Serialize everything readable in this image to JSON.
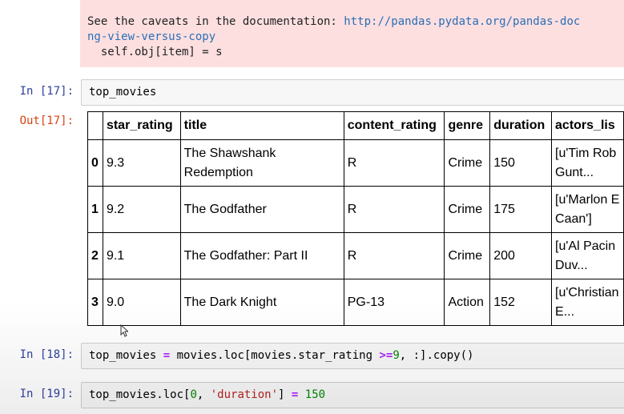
{
  "stderr": {
    "line1_text": "See the caveats in the documentation: ",
    "line1_link": "http://pandas.pydata.org/pandas-doc",
    "line2_link": "ng-view-versus-copy",
    "line3": "  self.obj[item] = s"
  },
  "cells": {
    "in17": {
      "prompt": "In [17]:",
      "code": "top_movies"
    },
    "out17": {
      "prompt": "Out[17]:"
    },
    "in18": {
      "prompt": "In [18]:",
      "code_a": "top_movies ",
      "op_eq": "=",
      "code_b": " movies.loc[movies.star_rating ",
      "op_ge": ">=",
      "num_9": "9",
      "code_c": ", :].copy()"
    },
    "in19": {
      "prompt": "In [19]:",
      "code_a": "top_movies.loc[",
      "num_0": "0",
      "code_b": ", ",
      "str_duration": "'duration'",
      "code_c": "] ",
      "op_eq": "=",
      "code_d": " ",
      "num_150": "150"
    }
  },
  "dataframe": {
    "columns": [
      "",
      "star_rating",
      "title",
      "content_rating",
      "genre",
      "duration",
      "actors_lis"
    ],
    "rows": [
      {
        "index": "0",
        "star_rating": "9.3",
        "title": "The Shawshank Redemption",
        "content_rating": "R",
        "genre": "Crime",
        "duration": "150",
        "actors_list": "[u'Tim Rob Gunt..."
      },
      {
        "index": "1",
        "star_rating": "9.2",
        "title": "The Godfather",
        "content_rating": "R",
        "genre": "Crime",
        "duration": "175",
        "actors_list": "[u'Marlon E Caan']"
      },
      {
        "index": "2",
        "star_rating": "9.1",
        "title": "The Godfather: Part II",
        "content_rating": "R",
        "genre": "Crime",
        "duration": "200",
        "actors_list": "[u'Al Pacin Duv..."
      },
      {
        "index": "3",
        "star_rating": "9.0",
        "title": "The Dark Knight",
        "content_rating": "PG-13",
        "genre": "Action",
        "duration": "152",
        "actors_list": "[u'Christian E..."
      }
    ]
  },
  "colors": {
    "stderr_bg": "#fddfe0",
    "link": "#2a6fb5",
    "prompt_in": "#303f9f",
    "prompt_out": "#d84315",
    "operator": "#aa22ff",
    "number": "#008800",
    "string": "#ba2121"
  },
  "icons": {
    "cursor": "mouse-pointer-icon"
  }
}
